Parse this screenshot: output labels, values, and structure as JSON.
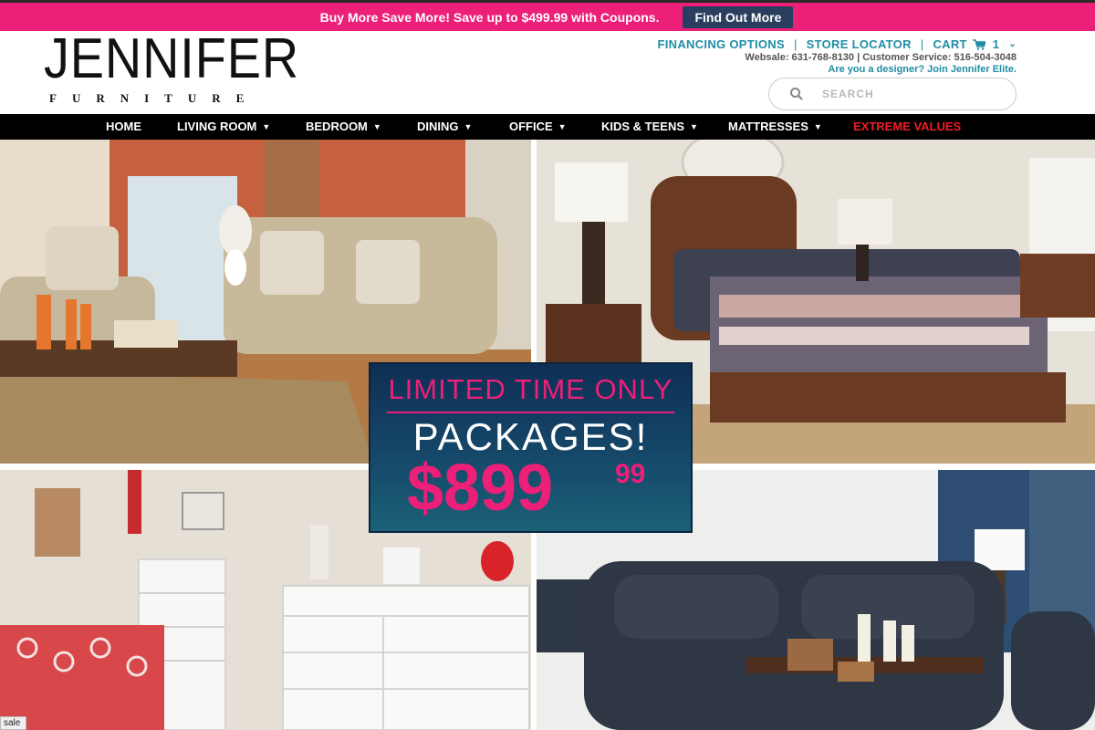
{
  "promo": {
    "text": "Buy More Save More! Save up to $499.99 with Coupons.",
    "button": "Find Out More"
  },
  "logo": {
    "main": "JENNIFER",
    "sub": "FURNITURE"
  },
  "header": {
    "financing": "FINANCING OPTIONS",
    "store_locator": "STORE LOCATOR",
    "cart_label": "CART",
    "cart_count": "1",
    "separator": "|",
    "contact": "Websale: 631-768-8130 | Customer Service: 516-504-3048",
    "designer": "Are you a designer? Join Jennifer Elite."
  },
  "search": {
    "placeholder": "SEARCH"
  },
  "nav": {
    "items": [
      {
        "label": "HOME"
      },
      {
        "label": "LIVING ROOM"
      },
      {
        "label": "BEDROOM"
      },
      {
        "label": "DINING"
      },
      {
        "label": "OFFICE"
      },
      {
        "label": "KIDS & TEENS"
      },
      {
        "label": "MATTRESSES"
      },
      {
        "label": "EXTREME VALUES"
      }
    ]
  },
  "hero_promo": {
    "line1": "LIMITED TIME ONLY",
    "line2": "PACKAGES!",
    "price": "$899",
    "cents": "99"
  },
  "status_bar": "sale",
  "colors": {
    "brand_pink": "#ec1f79",
    "link_teal": "#1f8da5",
    "nav_bg": "#000000",
    "extreme_red": "#ee1d25",
    "button_navy": "#2a3f5f"
  }
}
